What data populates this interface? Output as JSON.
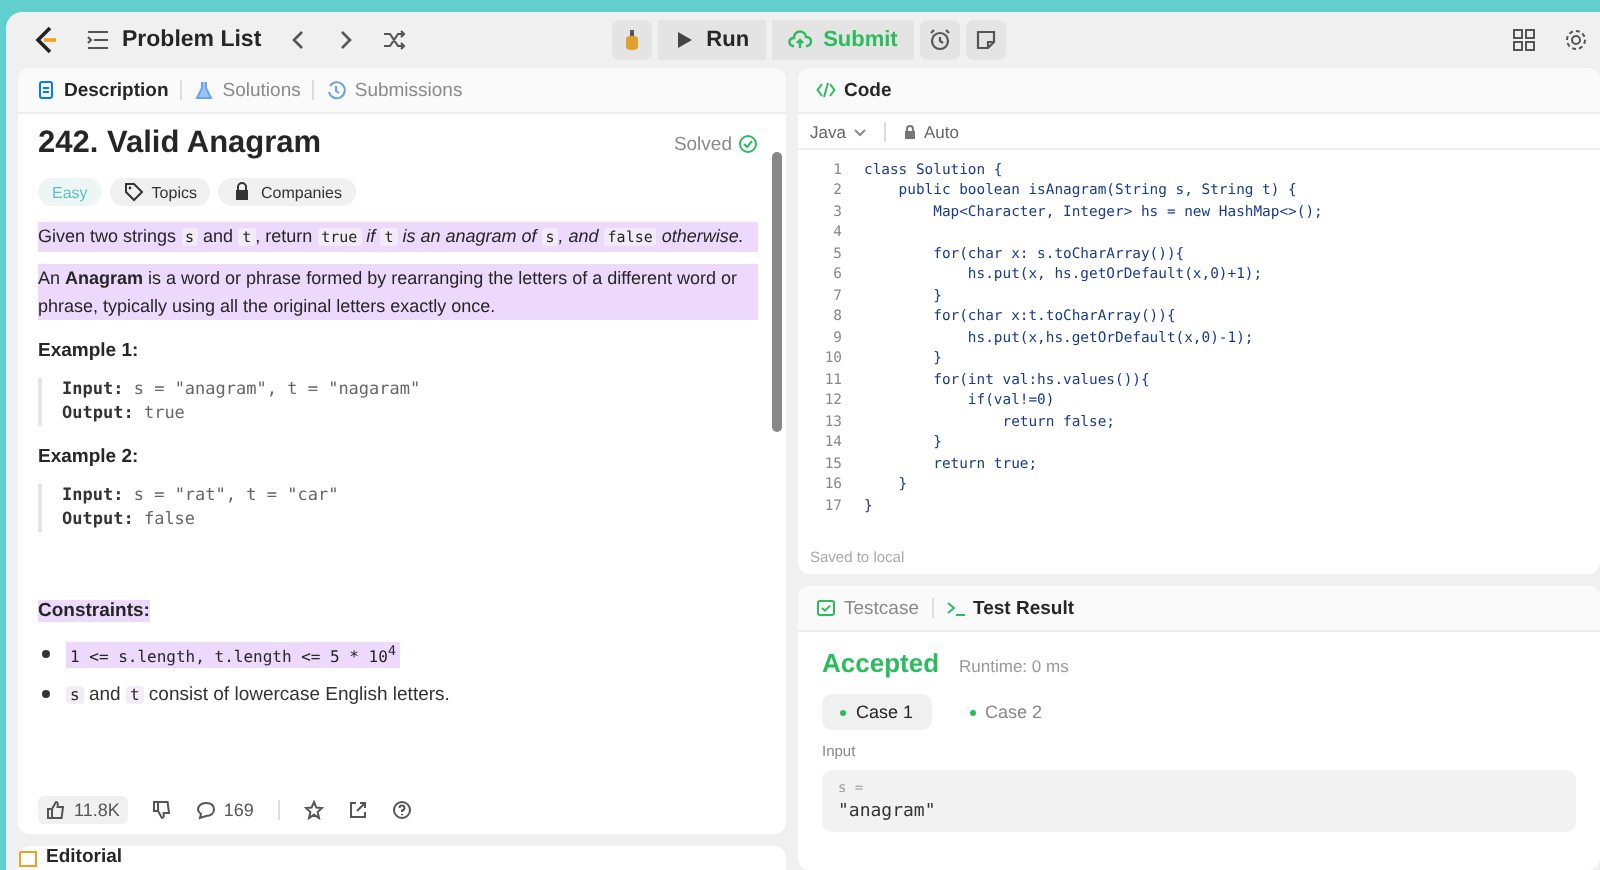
{
  "topbar": {
    "problem_list": "Problem List",
    "run": "Run",
    "submit": "Submit"
  },
  "left_tabs": [
    {
      "label": "Description",
      "selected": true
    },
    {
      "label": "Solutions",
      "selected": false
    },
    {
      "label": "Submissions",
      "selected": false
    }
  ],
  "problem": {
    "title": "242. Valid Anagram",
    "status": "Solved",
    "difficulty": "Easy",
    "tags": [
      "Topics",
      "Companies"
    ],
    "statement": [
      {
        "kind": "text",
        "text": "Given two strings "
      },
      {
        "kind": "code",
        "text": "s"
      },
      {
        "kind": "text",
        "text": " and "
      },
      {
        "kind": "code",
        "text": "t"
      },
      {
        "kind": "text",
        "text": ", return "
      },
      {
        "kind": "code",
        "text": "true"
      },
      {
        "kind": "italic",
        "text": " if "
      },
      {
        "kind": "code",
        "text": "t"
      },
      {
        "kind": "italic",
        "text": " is an anagram of "
      },
      {
        "kind": "code",
        "text": "s"
      },
      {
        "kind": "italic",
        "text": ", and "
      },
      {
        "kind": "code",
        "text": "false"
      },
      {
        "kind": "italic",
        "text": " otherwise."
      }
    ],
    "definition": "An **Anagram** is a word or phrase formed by rearranging the letters of a different word or phrase, typically using all the original letters exactly once.",
    "examples": [
      {
        "title": "Example 1:",
        "input_label": "Input:",
        "input": "s = \"anagram\", t = \"nagaram\"",
        "output_label": "Output:",
        "output": "true"
      },
      {
        "title": "Example 2:",
        "input_label": "Input:",
        "input": "s = \"rat\", t = \"car\"",
        "output_label": "Output:",
        "output": "false"
      }
    ],
    "constraints_title": "Constraints:",
    "constraints": [
      [
        {
          "kind": "code",
          "text": "1 <= s.length, t.length <= 5 * 10$^{4}$"
        }
      ],
      [
        {
          "kind": "code",
          "text": "s"
        },
        {
          "kind": "text",
          "text": " and "
        },
        {
          "kind": "code",
          "text": "t"
        },
        {
          "kind": "text",
          "text": " consist of lowercase English letters."
        }
      ]
    ],
    "likes": "11.8K",
    "comments": "169"
  },
  "editorial_tab": "Editorial",
  "code_panel": {
    "title": "Code",
    "language": "Java",
    "mode": "Auto",
    "saved": "Saved to local",
    "lines": [
      {
        "no": "1",
        "text": "class Solution {"
      },
      {
        "no": "2",
        "text": "    public boolean isAnagram(String s, String t) {"
      },
      {
        "no": "3",
        "text": "        Map<Character, Integer> hs = new HashMap<>();"
      },
      {
        "no": "4"
      },
      {
        "no": "5",
        "text": "        for(char x: s.toCharArray()){"
      },
      {
        "no": "6",
        "text": "            hs.put(x, hs.getOrDefault(x,0)+1);"
      },
      {
        "no": "7",
        "text": "        }"
      },
      {
        "no": "8",
        "text": "        for(char x:t.toCharArray()){"
      },
      {
        "no": "9",
        "text": "            hs.put(x,hs.getOrDefault(x,0)-1);"
      },
      {
        "no": "10",
        "text": "        }"
      },
      {
        "no": "11",
        "text": "        for(int val:hs.values()){"
      },
      {
        "no": "12",
        "text": "            if(val!=0)"
      },
      {
        "no": "13",
        "text": "                return false;"
      },
      {
        "no": "14",
        "text": "        }"
      },
      {
        "no": "15",
        "text": "        return true;"
      },
      {
        "no": "16",
        "text": "    }"
      },
      {
        "no": "17",
        "text": "}"
      }
    ]
  },
  "result_tabs": [
    {
      "label": "Testcase",
      "selected": false
    },
    {
      "label": "Test Result",
      "selected": true
    }
  ],
  "result": {
    "verdict": "Accepted",
    "runtime": "Runtime: 0 ms",
    "cases": [
      {
        "label": "Case 1",
        "selected": true
      },
      {
        "label": "Case 2",
        "selected": false
      }
    ],
    "input_label": "Input",
    "var": "s =",
    "value": "\"anagram\""
  }
}
